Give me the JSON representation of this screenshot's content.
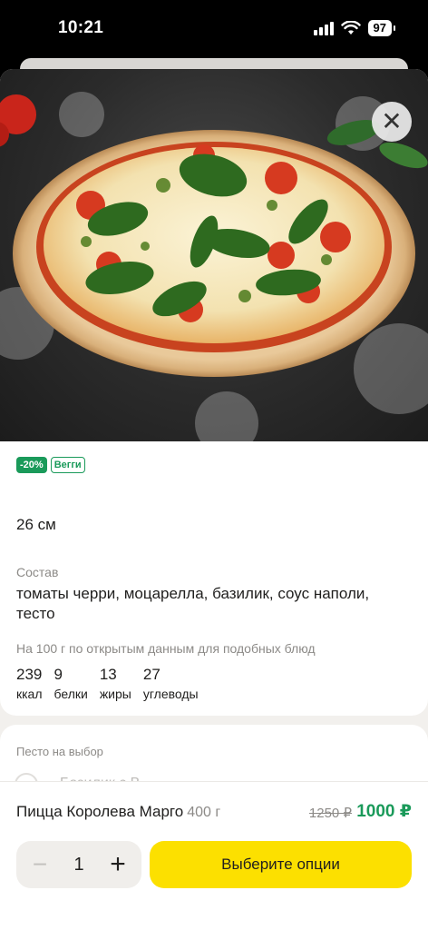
{
  "status": {
    "time": "10:21",
    "battery": "97"
  },
  "product": {
    "badges": [
      "-20%",
      "Вегги"
    ],
    "size": "26 см",
    "composition_label": "Состав",
    "composition": "томаты черри, моцарелла, базилик, соус наполи, тесто",
    "nutrition_note": "На 100 г по открытым данным для подобных блюд",
    "nutrition": [
      {
        "value": "239",
        "unit": "ккал"
      },
      {
        "value": "9",
        "unit": "белки"
      },
      {
        "value": "13",
        "unit": "жиры"
      },
      {
        "value": "27",
        "unit": "углеводы"
      }
    ],
    "name": "Пицца Королева Марго",
    "weight": "400 г",
    "old_price": "1250 ₽",
    "price": "1000 ₽"
  },
  "options": {
    "label": "Песто на выбор",
    "first_option": "Базилик с В..."
  },
  "cart": {
    "quantity": "1",
    "minus": "−",
    "plus": "+",
    "choose_label": "Выберите опции"
  },
  "icons": {
    "close": "close-icon",
    "wifi": "wifi-icon",
    "signal": "signal-icon"
  },
  "colors": {
    "accent_yellow": "#fce000",
    "green": "#1a9a5a"
  }
}
